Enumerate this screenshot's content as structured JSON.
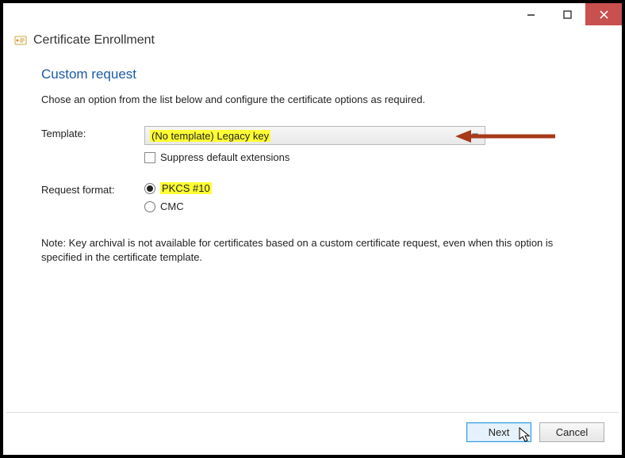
{
  "titlebar": {
    "minimize": "Minimize",
    "maximize": "Maximize",
    "close": "Close"
  },
  "header": {
    "title": "Certificate Enrollment"
  },
  "section": {
    "title": "Custom request",
    "instruction": "Chose an option from the list below and configure the certificate options as required."
  },
  "form": {
    "template_label": "Template:",
    "template_value": "(No template) Legacy key",
    "suppress_label": "Suppress default extensions",
    "suppress_checked": false,
    "format_label": "Request format:",
    "request_formats": {
      "pkcs10": {
        "label": "PKCS #10",
        "selected": true
      },
      "cmc": {
        "label": "CMC",
        "selected": false
      }
    }
  },
  "note": "Note: Key archival is not available for certificates based on a custom certificate request, even when this option is specified in the certificate template.",
  "footer": {
    "next": "Next",
    "cancel": "Cancel"
  }
}
